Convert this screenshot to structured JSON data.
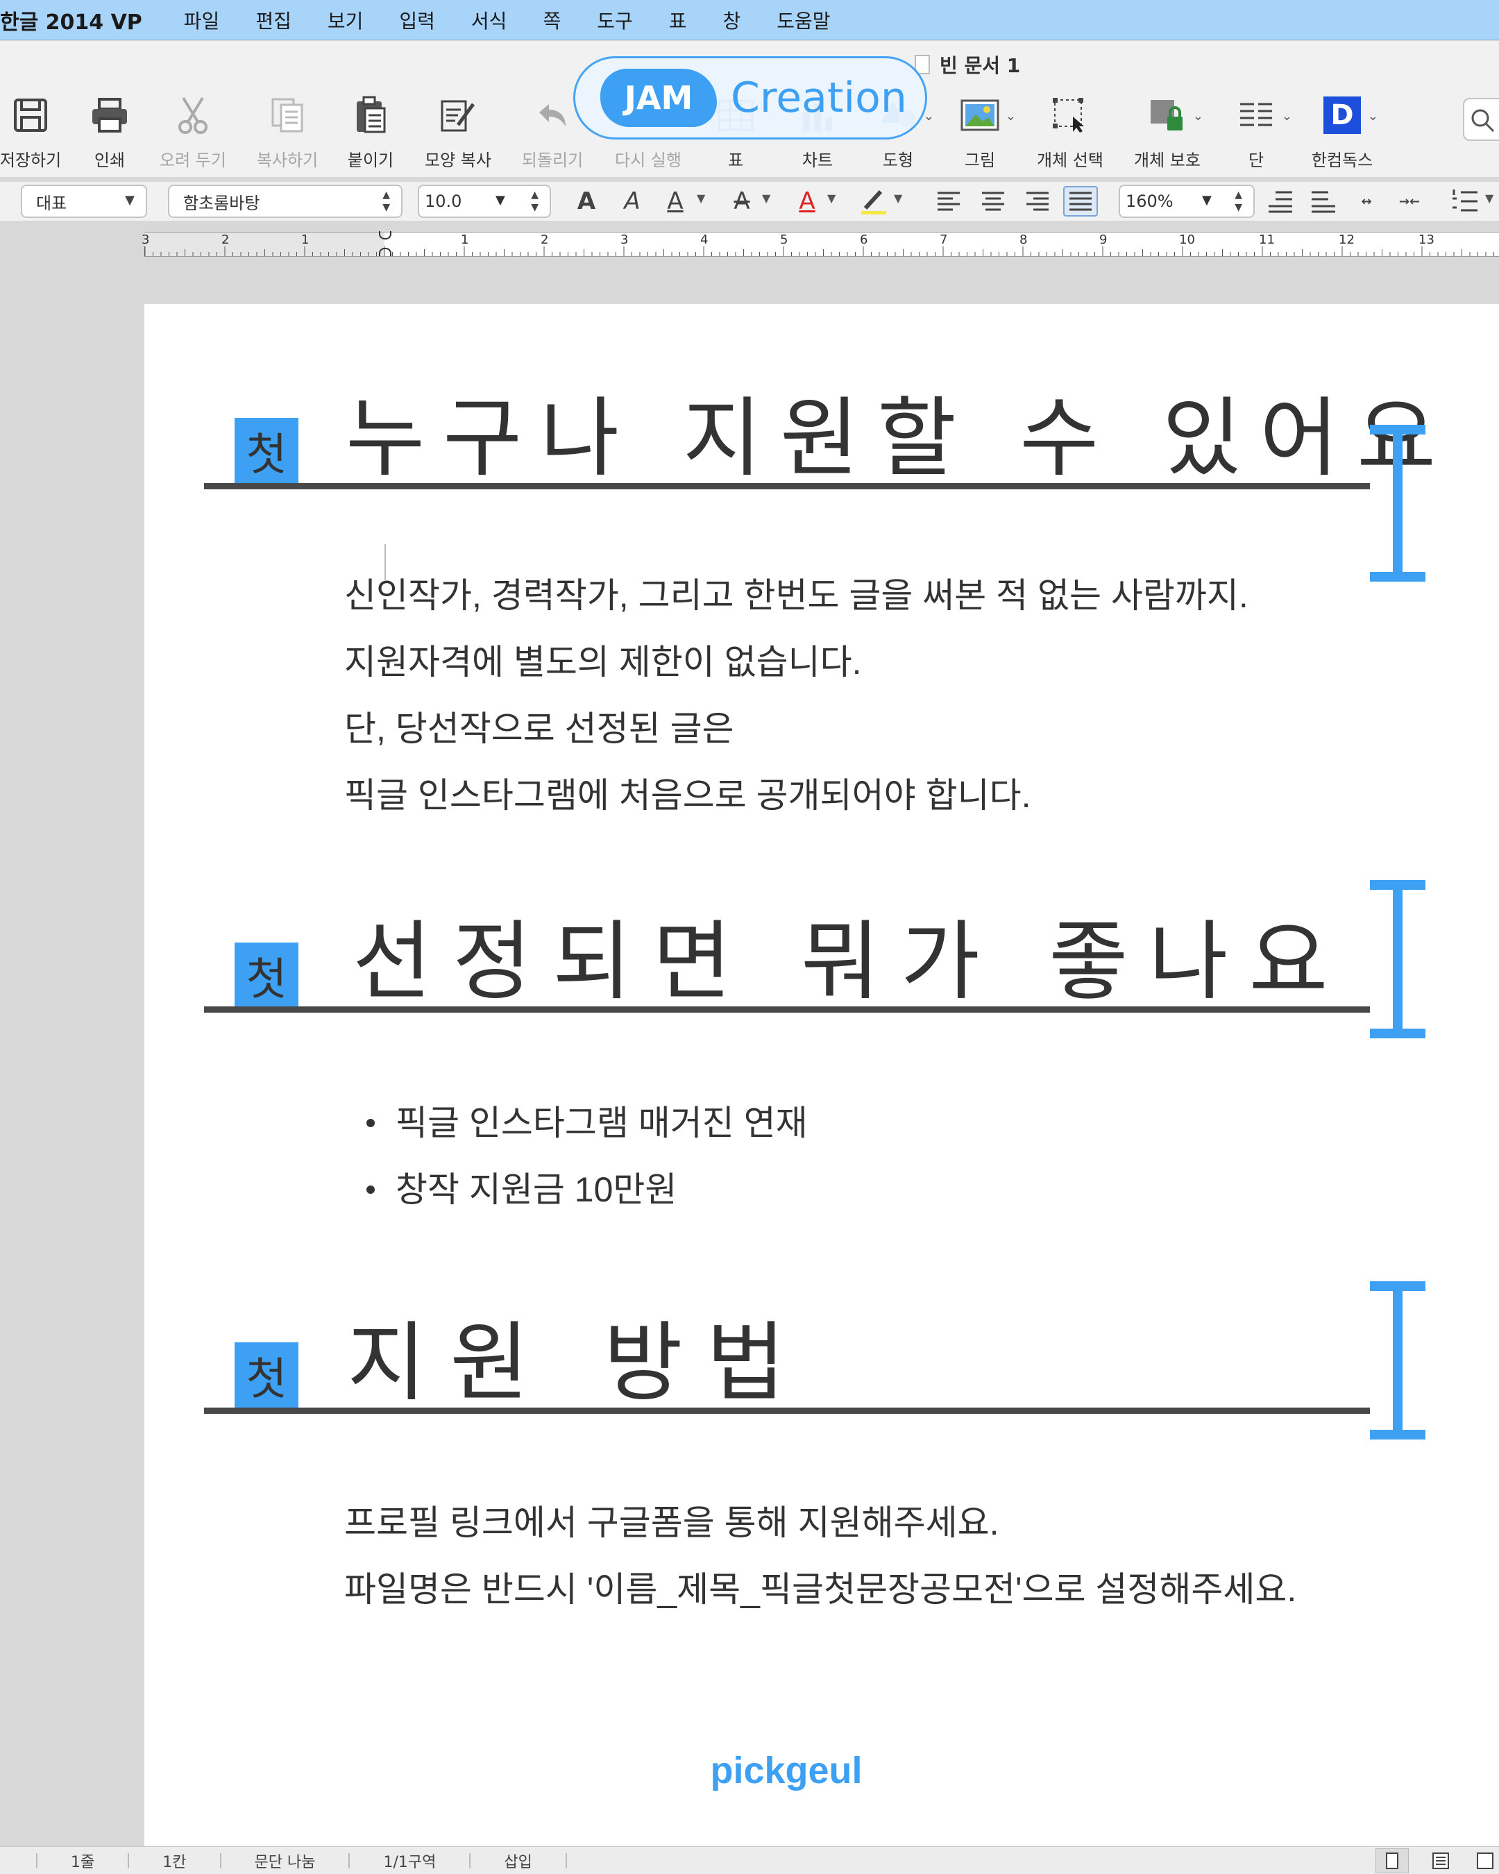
{
  "app": {
    "name": "한글 2014 VP",
    "menu": [
      "파일",
      "편집",
      "보기",
      "입력",
      "서식",
      "쪽",
      "도구",
      "표",
      "창",
      "도움말"
    ]
  },
  "document": {
    "title": "빈 문서 1"
  },
  "logo": {
    "badge": "JAM",
    "text": "Creation"
  },
  "toolbar": {
    "tools": [
      {
        "label": "저장하기",
        "icon": "save-icon",
        "disabled": false
      },
      {
        "label": "인쇄",
        "icon": "print-icon",
        "disabled": false
      },
      {
        "label": "오려 두기",
        "icon": "cut-icon",
        "disabled": true
      },
      {
        "label": "복사하기",
        "icon": "copy-icon",
        "disabled": true
      },
      {
        "label": "붙이기",
        "icon": "paste-icon",
        "disabled": false
      },
      {
        "label": "모양 복사",
        "icon": "format-painter-icon",
        "disabled": false
      },
      {
        "label": "되돌리기",
        "icon": "undo-icon",
        "disabled": true
      },
      {
        "label": "다시 실행",
        "icon": "redo-icon",
        "disabled": true
      },
      {
        "label": "표",
        "icon": "table-icon",
        "disabled": false
      },
      {
        "label": "차트",
        "icon": "chart-icon",
        "disabled": false
      },
      {
        "label": "도형",
        "icon": "shape-icon",
        "disabled": false
      },
      {
        "label": "그림",
        "icon": "picture-icon",
        "disabled": false
      },
      {
        "label": "개체 선택",
        "icon": "object-select-icon",
        "disabled": false
      },
      {
        "label": "개체 보호",
        "icon": "object-protect-icon",
        "disabled": false
      },
      {
        "label": "단",
        "icon": "columns-icon",
        "disabled": false
      },
      {
        "label": "한컴독스",
        "icon": "hancomdocs-icon",
        "disabled": false
      }
    ],
    "hancomdocs_letter": "D"
  },
  "formatbar": {
    "style": "대표",
    "font": "함초롬바탕",
    "size": "10.0",
    "zoom": "160%",
    "bold_glyph": "A",
    "italic_glyph": "A",
    "underline_glyph": "A",
    "strike_glyph": "A",
    "color_glyph": "A"
  },
  "ruler": {
    "left_labels": [
      "3",
      "2",
      "1"
    ],
    "right_labels": [
      "1",
      "2",
      "3",
      "4",
      "5",
      "6",
      "7",
      "8",
      "9",
      "10",
      "11",
      "12",
      "13"
    ]
  },
  "content": {
    "badge_char": "첫",
    "sections": [
      {
        "title": "누구나 지원할 수 있어요",
        "lines": [
          "신인작가, 경력작가, 그리고 한번도 글을 써본 적 없는 사람까지.",
          "지원자격에 별도의 제한이 없습니다.",
          "단, 당선작으로 선정된 글은",
          "픽글 인스타그램에 처음으로 공개되어야 합니다."
        ]
      },
      {
        "title": "선정되면 뭐가 좋나요",
        "bullets": [
          "픽글 인스타그램 매거진 연재",
          "창작 지원금 10만원"
        ]
      },
      {
        "title": "지원 방법",
        "lines": [
          "프로필 링크에서 구글폼을 통해 지원해주세요.",
          "파일명은 반드시 '이름_제목_픽글첫문장공모전'으로 설정해주세요."
        ]
      }
    ],
    "footer": "pickgeul"
  },
  "statusbar": {
    "items": [
      "1줄",
      "1칸",
      "문단 나눔",
      "1/1구역",
      "삽입"
    ]
  },
  "colors": {
    "accent": "#3ea0f2",
    "menubar": "#a8d4fa",
    "rule": "#484848",
    "text": "#333333"
  }
}
